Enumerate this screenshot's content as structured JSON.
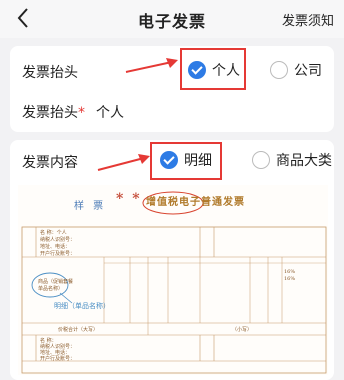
{
  "header": {
    "title": "电子发票",
    "help_link": "发票须知"
  },
  "invoice_header_section": {
    "title_label": "发票抬头",
    "options": [
      {
        "label": "个人",
        "selected": true
      },
      {
        "label": "公司",
        "selected": false
      }
    ],
    "name_label": "发票抬头",
    "required_mark": "*",
    "name_value": "个人"
  },
  "invoice_content_section": {
    "label": "发票内容",
    "options": [
      {
        "label": "明细",
        "selected": true
      },
      {
        "label": "商品大类",
        "selected": false
      }
    ]
  },
  "sample_invoice": {
    "watermark": "样 票",
    "stars": "* *",
    "title": "增值税电子普通发票",
    "callout": "明细（单品名称）",
    "tiny_labels": {
      "buyer_name": "名    称：个人",
      "buyer_tax": "纳税人识别号：",
      "buyer_addr": "地址、电话：",
      "buyer_bank": "开户行及账号：",
      "item1": "商品（促销套餐",
      "item2": "单品名称）",
      "total": "价税合计（大写）",
      "small": "（小写）",
      "seller_name": "名    称：",
      "seller_tax": "纳税人识别号：",
      "seller_addr": "地址、电话：",
      "seller_bank": "开户行及账号：",
      "rate1": "16%",
      "rate2": "16%"
    }
  },
  "colors": {
    "accent": "#2d7be5",
    "highlight": "#e53935"
  }
}
